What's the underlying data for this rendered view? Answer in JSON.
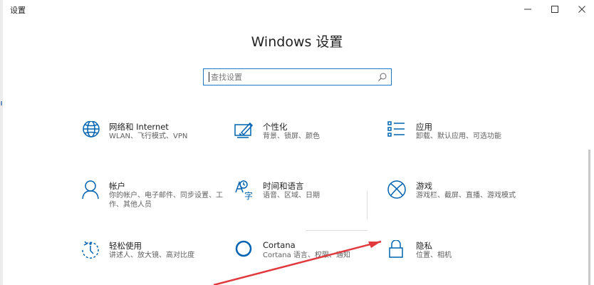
{
  "window": {
    "title": "设置",
    "minimize_label": "—",
    "maximize_label": "☐",
    "close_label": "✕"
  },
  "header": {
    "title": "Windows 设置"
  },
  "search": {
    "placeholder": "查找设置",
    "icon": "search-icon"
  },
  "colors": {
    "accent": "#1979ca",
    "icon": "#0063b1",
    "arrow": "#e0393e"
  },
  "tiles": [
    {
      "icon": "globe-icon",
      "title": "网络和 Internet",
      "desc": "WLAN、飞行模式、VPN"
    },
    {
      "icon": "personalization-icon",
      "title": "个性化",
      "desc": "背景、锁屏、颜色"
    },
    {
      "icon": "apps-icon",
      "title": "应用",
      "desc": "卸载、默认应用、可选功能"
    },
    {
      "icon": "account-icon",
      "title": "帐户",
      "desc": "你的帐户、电子邮件、同步设置、工作、其他人员"
    },
    {
      "icon": "time-language-icon",
      "title": "时间和语言",
      "desc": "语音、区域、日期"
    },
    {
      "icon": "xbox-icon",
      "title": "游戏",
      "desc": "游戏栏、截屏、直播、游戏模式"
    },
    {
      "icon": "ease-of-access-icon",
      "title": "轻松使用",
      "desc": "讲述人、放大镜、高对比度"
    },
    {
      "icon": "cortana-icon",
      "title": "Cortana",
      "desc": "Cortana 语言、权限、通知"
    },
    {
      "icon": "lock-icon",
      "title": "隐私",
      "desc": "位置、相机"
    }
  ]
}
